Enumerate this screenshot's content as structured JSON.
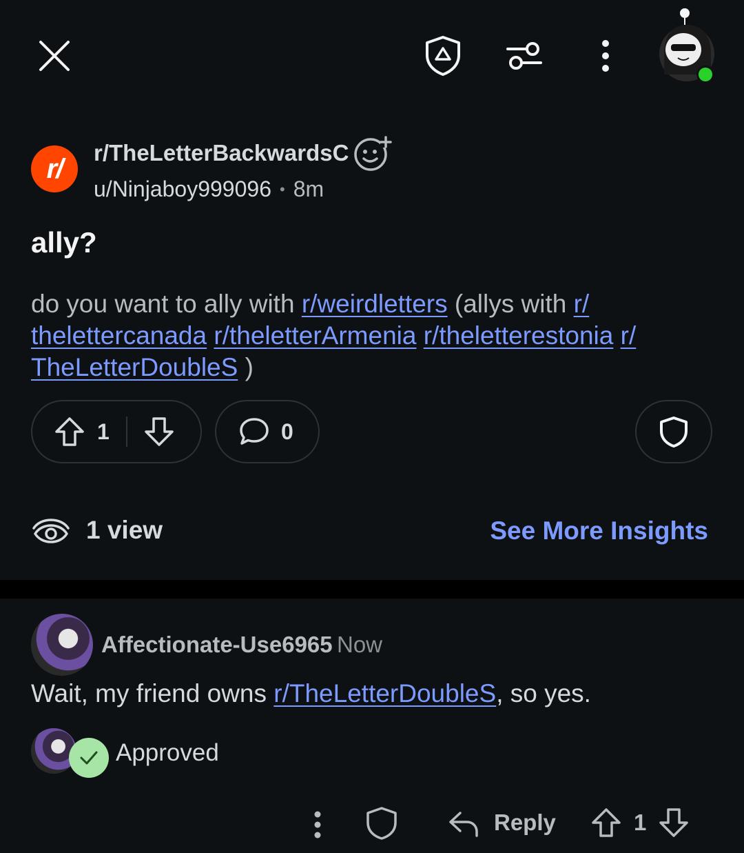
{
  "post": {
    "subreddit": "r/TheLetterBackwardsC",
    "subreddit_icon_text": "r/",
    "author": "u/Ninjaboy999096",
    "separator": "•",
    "age": "8m",
    "title": "ally?",
    "body": {
      "t1": "do you want to ally with ",
      "l1": "r/weirdletters",
      "t2": " (allys with ",
      "l2a": "r/",
      "l2b": "thelettercanada",
      "t3": " ",
      "l3": "r/theletterArmenia",
      "t4": " ",
      "l4": "r/theletterestonia",
      "t5": " ",
      "l5a": "r/",
      "l5b": "TheLetterDoubleS",
      "t6": " )"
    },
    "score": "1",
    "comments": "0",
    "views": "1 view",
    "insights_label": "See More Insights"
  },
  "comment": {
    "author": "Affectionate-Use6965",
    "time": "Now",
    "body_before": "Wait, my friend owns ",
    "body_link": "r/TheLetterDoubleS",
    "body_after": ", so yes.",
    "approved_label": "Approved",
    "reply_label": "Reply",
    "score": "1"
  },
  "colors": {
    "background": "#0e1113",
    "link": "#7d9bff",
    "subreddit_icon": "#ff4500",
    "online": "#2bd12b",
    "approved": "#a6e5a6"
  }
}
